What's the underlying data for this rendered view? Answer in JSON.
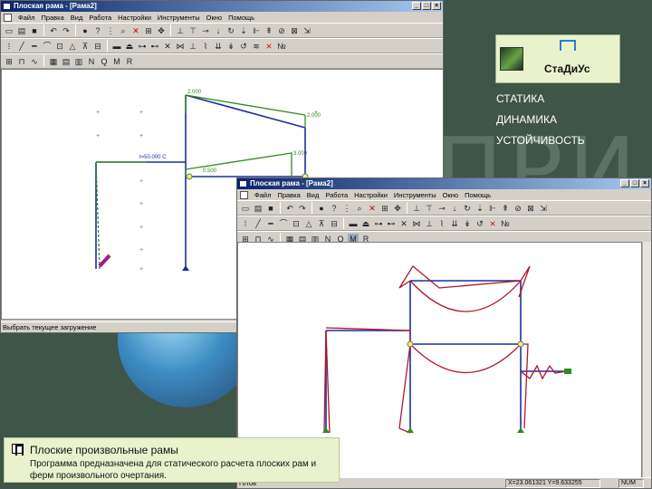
{
  "slide": {
    "bg_word": "ПРИ",
    "brand_name": "СтаДиУс",
    "topics": [
      "СТАТИКА",
      "ДИНАМИКА",
      "УСТОЙЧИВОСТЬ"
    ],
    "caption_title": "Плоские  произвольные рамы",
    "caption_text": "Программа предназначена для статического расчета плоских рам и ферм произвольного очертания."
  },
  "window1": {
    "title": "Плоская рама - [Рама2]",
    "menu": [
      "Файл",
      "Правка",
      "Вид",
      "Работа",
      "Настройки",
      "Инструменты",
      "Окно",
      "Помощь"
    ],
    "status": "Выбрать текущее загружение",
    "toolbar_icons": [
      "new-icon",
      "open-icon",
      "save-icon",
      "undo-icon",
      "redo-icon",
      "copy-icon",
      "paste-icon",
      "zoom-icon",
      "delete-icon",
      "grid-icon"
    ],
    "labels": {
      "load_top": "2.000",
      "load_right": "2.000",
      "load_mid": "3.000",
      "load_left": "0.500",
      "temperature": "t=50.000 C"
    }
  },
  "window2": {
    "title": "Плоская рама - [Рама2]",
    "menu": [
      "Файл",
      "Правка",
      "Вид",
      "Работа",
      "Настройки",
      "Инструменты",
      "Окно",
      "Помощь"
    ],
    "status": "Готов",
    "coords": "X=23.061321 Y=9.633255",
    "num": "NUM"
  },
  "colors": {
    "frame_blue": "#1c2f9e",
    "load_green": "#2e8b1e",
    "diagram_red": "#b0172b",
    "slide_bg": "#3f5547",
    "caption_bg": "#e9f2cd"
  }
}
